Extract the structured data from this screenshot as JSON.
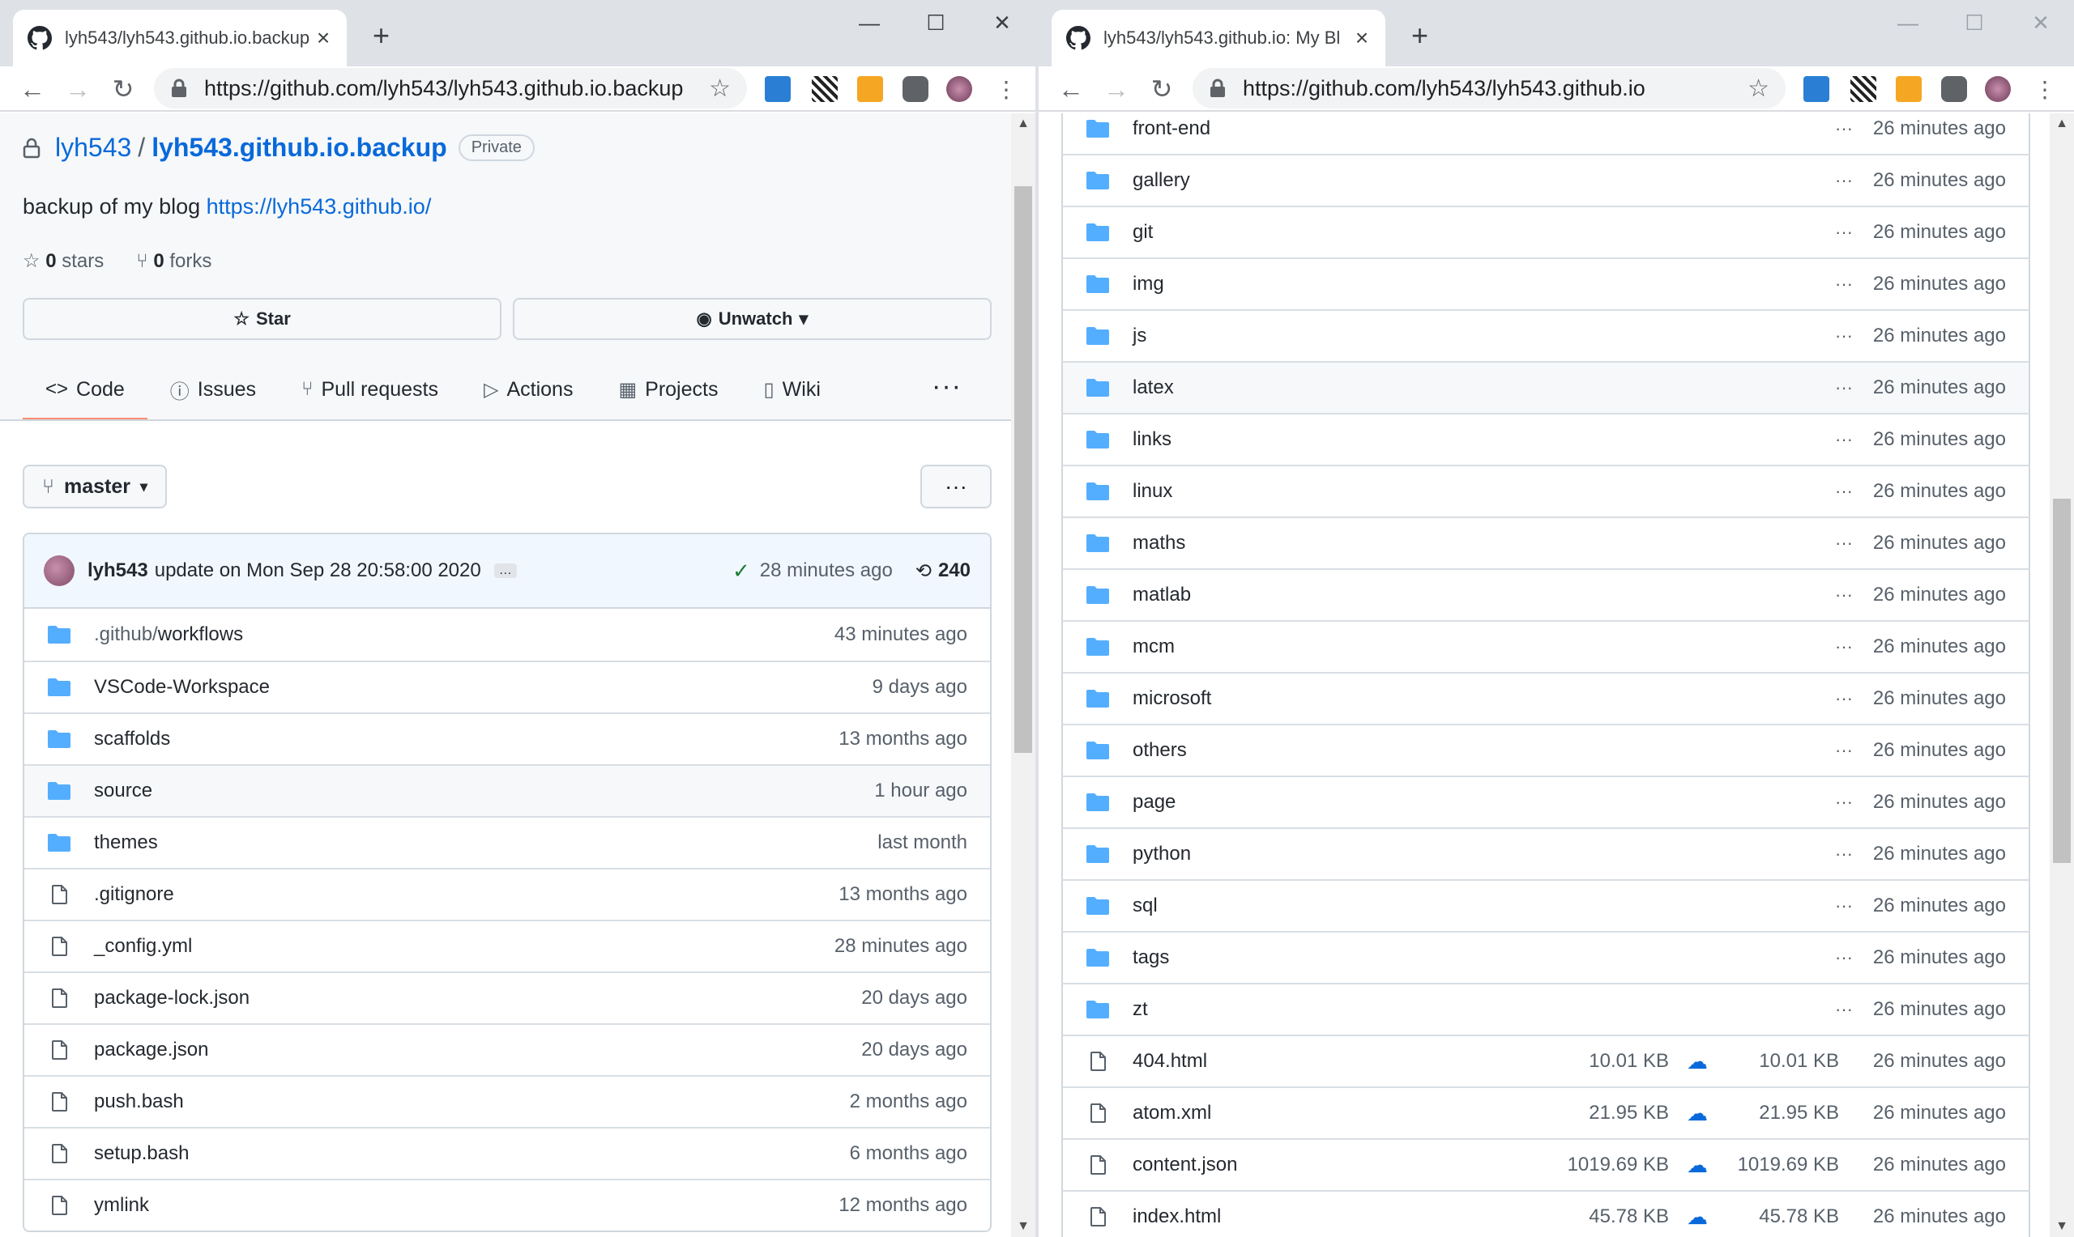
{
  "left": {
    "tab_title": "lyh543/lyh543.github.io.backup",
    "url": "https://github.com/lyh543/lyh543.github.io.backup",
    "owner": "lyh543",
    "repo": "lyh543.github.io.backup",
    "visibility": "Private",
    "description": "backup of my blog",
    "description_link": "https://lyh543.github.io/",
    "stars": "0",
    "stars_label": "stars",
    "forks": "0",
    "forks_label": "forks",
    "star_button": "Star",
    "unwatch_button": "Unwatch",
    "nav": [
      "Code",
      "Issues",
      "Pull requests",
      "Actions",
      "Projects",
      "Wiki"
    ],
    "branch": "master",
    "commit": {
      "user": "lyh543",
      "message": "update on Mon Sep 28 20:58:00 2020",
      "ellipsis": "…",
      "time": "28 minutes ago",
      "count": "240"
    },
    "files": [
      {
        "type": "dir",
        "dim": ".github/",
        "name": "workflows",
        "date": "43 minutes ago"
      },
      {
        "type": "dir",
        "name": "VSCode-Workspace",
        "date": "9 days ago"
      },
      {
        "type": "dir",
        "name": "scaffolds",
        "date": "13 months ago"
      },
      {
        "type": "dir",
        "name": "source",
        "date": "1 hour ago"
      },
      {
        "type": "dir",
        "name": "themes",
        "date": "last month"
      },
      {
        "type": "file",
        "name": ".gitignore",
        "date": "13 months ago"
      },
      {
        "type": "file",
        "name": "_config.yml",
        "date": "28 minutes ago"
      },
      {
        "type": "file",
        "name": "package-lock.json",
        "date": "20 days ago"
      },
      {
        "type": "file",
        "name": "package.json",
        "date": "20 days ago"
      },
      {
        "type": "file",
        "name": "push.bash",
        "date": "2 months ago"
      },
      {
        "type": "file",
        "name": "setup.bash",
        "date": "6 months ago"
      },
      {
        "type": "file",
        "name": "ymlink",
        "date": "12 months ago"
      }
    ]
  },
  "right": {
    "tab_title": "lyh543/lyh543.github.io: My Bl",
    "url": "https://github.com/lyh543/lyh543.github.io",
    "dirs": [
      "front-end",
      "gallery",
      "git",
      "img",
      "js",
      "latex",
      "links",
      "linux",
      "maths",
      "matlab",
      "mcm",
      "microsoft",
      "others",
      "page",
      "python",
      "sql",
      "tags",
      "zt"
    ],
    "dir_date": "26 minutes ago",
    "more": "···",
    "files": [
      {
        "name": "404.html",
        "size": "10.01 KB",
        "size2": "10.01 KB",
        "date": "26 minutes ago"
      },
      {
        "name": "atom.xml",
        "size": "21.95 KB",
        "size2": "21.95 KB",
        "date": "26 minutes ago"
      },
      {
        "name": "content.json",
        "size": "1019.69 KB",
        "size2": "1019.69 KB",
        "date": "26 minutes ago"
      },
      {
        "name": "index.html",
        "size": "45.78 KB",
        "size2": "45.78 KB",
        "date": "26 minutes ago"
      }
    ]
  },
  "colors": {
    "link": "#0969da",
    "tab_underline": "#fd8c73",
    "folder": "#54aeff",
    "check": "#1a7f37"
  }
}
